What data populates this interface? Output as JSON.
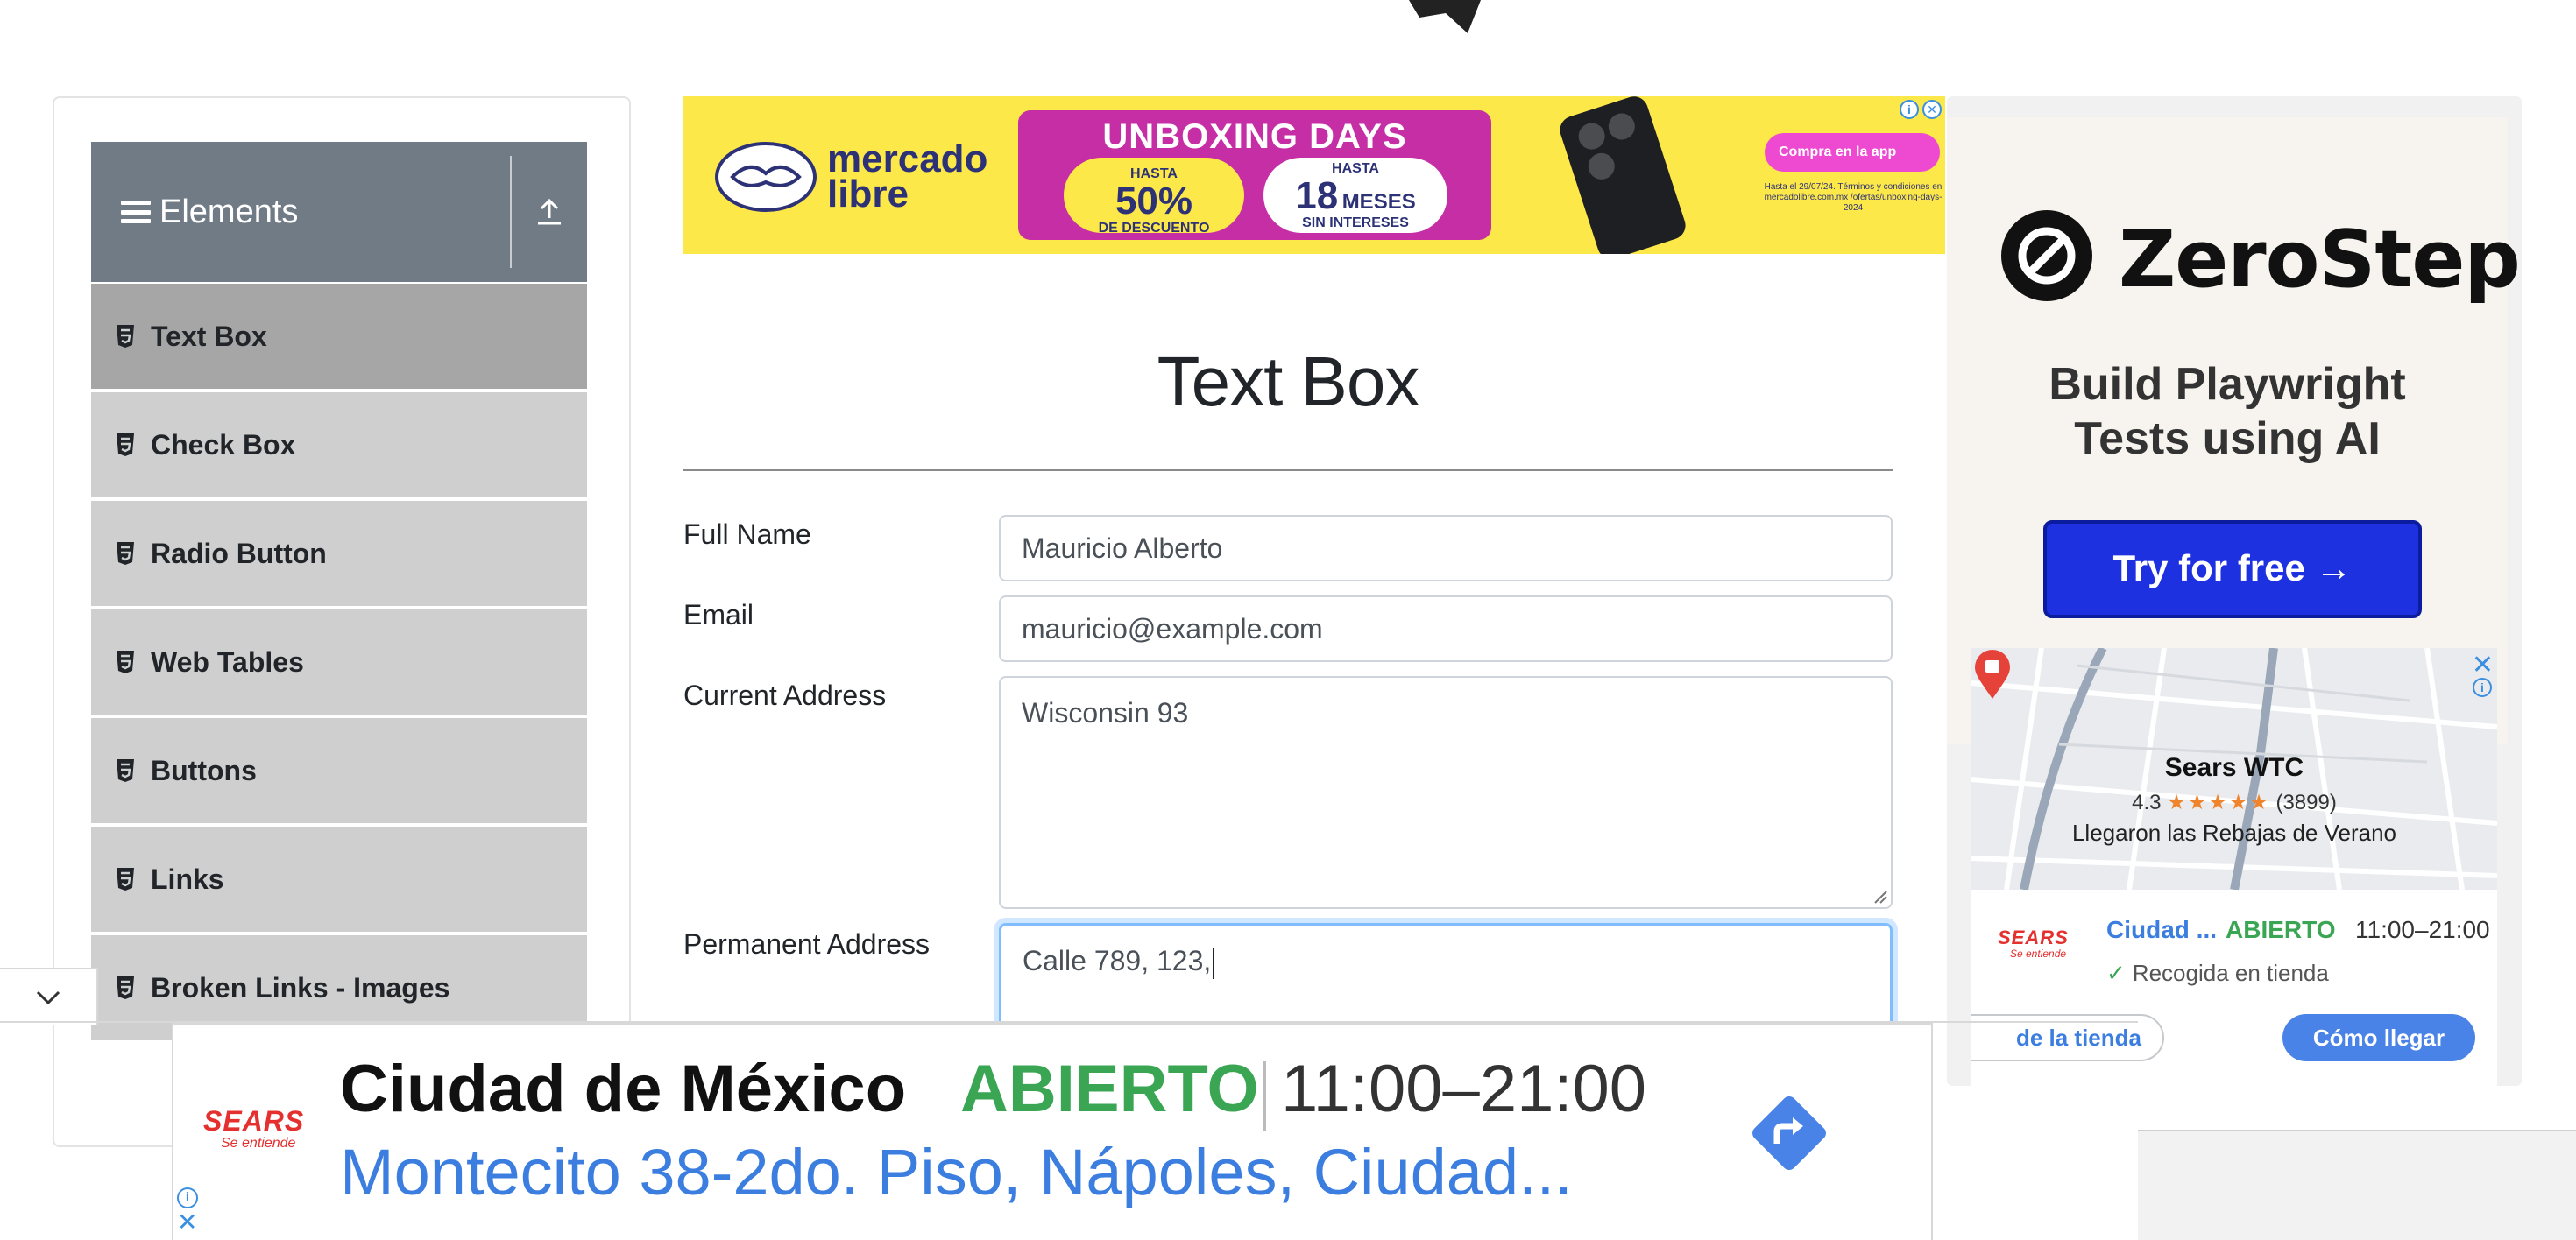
{
  "sidebar": {
    "group_title": "Elements",
    "items": [
      {
        "label": "Text Box",
        "active": true
      },
      {
        "label": "Check Box",
        "active": false
      },
      {
        "label": "Radio Button",
        "active": false
      },
      {
        "label": "Web Tables",
        "active": false
      },
      {
        "label": "Buttons",
        "active": false
      },
      {
        "label": "Links",
        "active": false
      },
      {
        "label": "Broken Links - Images",
        "active": false
      }
    ]
  },
  "top_ad": {
    "brand": "mercado\nlibre",
    "promo_title": "UNBOXING DAYS",
    "discount_small": "HASTA",
    "discount_big": "50%",
    "discount_caption": "DE DESCUENTO",
    "months_small": "HASTA",
    "months_big": "18",
    "months_word": "MESES",
    "months_caption": "SIN INTERESES",
    "cta": "Compra en la app",
    "fine_print": "Hasta el 29/07/24. Términos y condiciones en mercadolibre.com.mx /ofertas/unboxing-days-2024"
  },
  "form": {
    "title": "Text Box",
    "fields": [
      {
        "label": "Full Name",
        "value": "Mauricio Alberto"
      },
      {
        "label": "Email",
        "value": "mauricio@example.com"
      },
      {
        "label": "Current Address",
        "value": "Wisconsin 93"
      },
      {
        "label": "Permanent Address",
        "value": "Calle 789, 123,"
      }
    ]
  },
  "right_ad": {
    "brand": "ZeroStep",
    "tagline": "Build Playwright Tests using AI",
    "button": "Try for free →"
  },
  "map_ad": {
    "place": "Sears WTC",
    "rating": "4.3",
    "stars": "★★★★★",
    "reviews": "(3899)",
    "promo": "Llegaron las Rebajas de Verano",
    "city": "Ciudad ...",
    "status": "ABIERTO",
    "hours": "11:00–21:00",
    "pickup": "Recogida en tienda",
    "store_button": "de la tienda",
    "directions_button": "Cómo llegar",
    "logo_word": "SEARS",
    "logo_slogan": "Se entiende"
  },
  "bottom_ad": {
    "city": "Ciudad de México",
    "status": "ABIERTO",
    "hours": "11:00–21:00",
    "address": "Montecito 38-2do. Piso, Nápoles, Ciudad...",
    "logo_word": "SEARS",
    "logo_slogan": "Se entiende"
  },
  "colors": {
    "sidebar_header": "#717b86",
    "menu_item": "#cfcfcf",
    "menu_item_active": "#a6a6a6",
    "focus_border": "#80bdff",
    "ml_yellow": "#fde84a",
    "zs_button": "#1d31e0",
    "open_green": "#3aa654",
    "link_blue": "#3b7ee0"
  }
}
